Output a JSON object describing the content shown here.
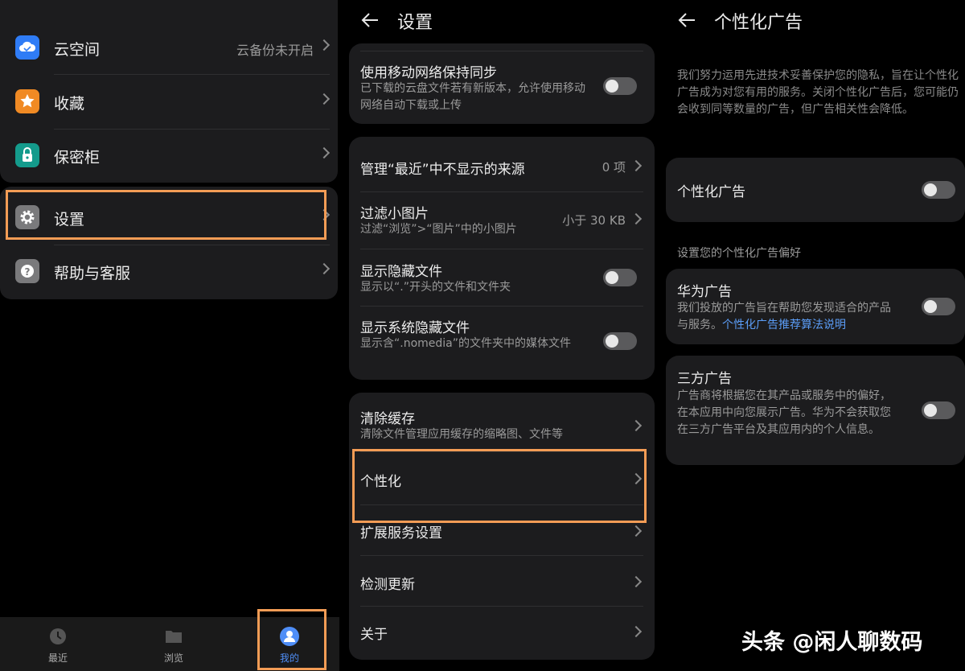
{
  "colors": {
    "accent": "#4f8ef7",
    "highlight": "#f39c55",
    "link": "#5b9df7"
  },
  "panel1": {
    "items": [
      {
        "label": "云空间",
        "value": "云备份未开启",
        "icon": "cloud-icon",
        "icon_color": "#2f7cf6"
      },
      {
        "label": "收藏",
        "value": "",
        "icon": "star-icon",
        "icon_color": "#f08a24"
      },
      {
        "label": "保密柜",
        "value": "",
        "icon": "lock-icon",
        "icon_color": "#149b8c"
      },
      {
        "label": "设置",
        "value": "",
        "icon": "gear-icon",
        "icon_color": "#7a7a7c"
      },
      {
        "label": "帮助与客服",
        "value": "",
        "icon": "help-icon",
        "icon_color": "#7a7a7c"
      }
    ],
    "tabs": [
      {
        "label": "最近",
        "icon": "clock-icon"
      },
      {
        "label": "浏览",
        "icon": "folder-icon"
      },
      {
        "label": "我的",
        "icon": "user-icon"
      }
    ]
  },
  "panel2": {
    "title": "设置",
    "sync": {
      "title": "使用移动网络保持同步",
      "desc": "已下载的云盘文件若有新版本，允许使用移动网络自动下载或上传"
    },
    "recent_sources": {
      "title": "管理“最近”中不显示的来源",
      "value": "0 项"
    },
    "filter_small": {
      "title": "过滤小图片",
      "desc": "过滤“浏览”>“图片”中的小图片",
      "value": "小于 30 KB"
    },
    "hidden_files": {
      "title": "显示隐藏文件",
      "desc": "显示以“.”开头的文件和文件夹"
    },
    "system_hidden": {
      "title": "显示系统隐藏文件",
      "desc": "显示含“.nomedia”的文件夹中的媒体文件"
    },
    "clear_cache": {
      "title": "清除缓存",
      "desc": "清除文件管理应用缓存的缩略图、文件等"
    },
    "personalize": {
      "title": "个性化"
    },
    "extension": {
      "title": "扩展服务设置"
    },
    "check_update": {
      "title": "检测更新"
    },
    "about": {
      "title": "关于"
    }
  },
  "panel3": {
    "title": "个性化广告",
    "intro": "我们努力运用先进技术妥善保护您的隐私，旨在让个性化广告成为对您有用的服务。关闭个性化广告后，您可能仍会收到同等数量的广告，但广告相关性会降低。",
    "personal_ads": {
      "title": "个性化广告"
    },
    "section_label": "设置您的个性化广告偏好",
    "huawei_ads": {
      "title": "华为广告",
      "desc": "我们投放的广告旨在帮助您发现适合的产品与服务。",
      "link": "个性化广告推荐算法说明"
    },
    "third_party_ads": {
      "title": "三方广告",
      "desc": "广告商将根据您在其产品或服务中的偏好，在本应用中向您展示广告。华为不会获取您在三方广告平台及其应用内的个人信息。"
    }
  },
  "watermark": "头条 @闲人聊数码"
}
